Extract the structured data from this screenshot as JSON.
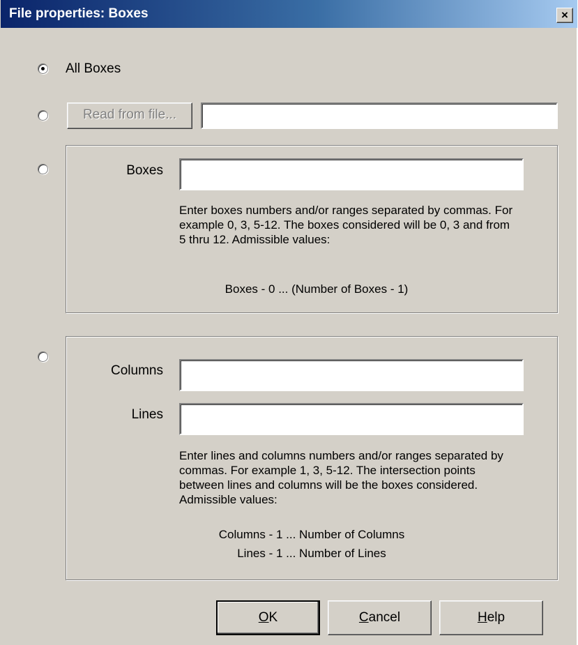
{
  "window": {
    "title": "File properties: Boxes",
    "close_glyph": "×"
  },
  "options": {
    "all_boxes_label": "All Boxes",
    "read_from_file_button": "Read from file...",
    "read_from_file_value": ""
  },
  "boxes_group": {
    "label": "Boxes",
    "value": "",
    "help": "Enter boxes numbers and/or ranges separated by commas. For example 0, 3, 5-12. The boxes considered will be 0, 3 and from 5 thru 12. Admissible values:",
    "range": "Boxes - 0 ... (Number of Boxes - 1)"
  },
  "grid_group": {
    "columns_label": "Columns",
    "columns_value": "",
    "lines_label": "Lines",
    "lines_value": "",
    "help": "Enter lines and columns numbers and/or ranges separated by commas. For example 1, 3, 5-12. The intersection points between lines and columns will be the boxes considered. Admissible values:",
    "columns_range": "Columns - 1 ... Number of Columns",
    "lines_range": "Lines - 1 ... Number of Lines"
  },
  "buttons": {
    "ok_mnemonic": "O",
    "ok_rest": "K",
    "cancel_mnemonic": "C",
    "cancel_rest": "ancel",
    "help_mnemonic": "H",
    "help_rest": "elp"
  },
  "selected_option": "all_boxes"
}
